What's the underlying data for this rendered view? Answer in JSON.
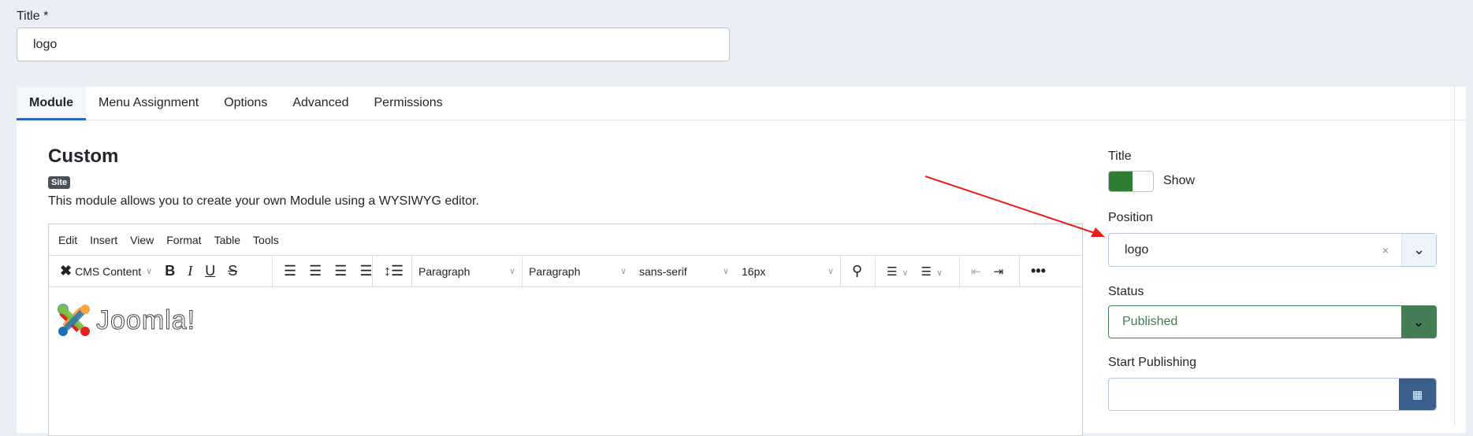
{
  "title_field": {
    "label": "Title *",
    "value": "logo"
  },
  "tabs": [
    "Module",
    "Menu Assignment",
    "Options",
    "Advanced",
    "Permissions"
  ],
  "module": {
    "heading": "Custom",
    "badge": "Site",
    "description": "This module allows you to create your own Module using a WYSIWYG editor."
  },
  "editor": {
    "menu": [
      "Edit",
      "Insert",
      "View",
      "Format",
      "Table",
      "Tools"
    ],
    "cms_content": "CMS Content",
    "block_format": "Paragraph",
    "paragraph": "Paragraph",
    "font_family": "sans-serif",
    "font_size": "16px",
    "content_image": "Joomla!"
  },
  "sidebar": {
    "title_label": "Title",
    "title_toggle": "Show",
    "position_label": "Position",
    "position_value": "logo",
    "clear": "×",
    "status_label": "Status",
    "status_value": "Published",
    "start_label": "Start Publishing",
    "start_value": ""
  },
  "colors": {
    "accent": "#2a69b8",
    "published": "#457d54",
    "toggle_on": "#2f7d32",
    "calendar": "#3c5e8c",
    "annotation": "#e8201c"
  }
}
